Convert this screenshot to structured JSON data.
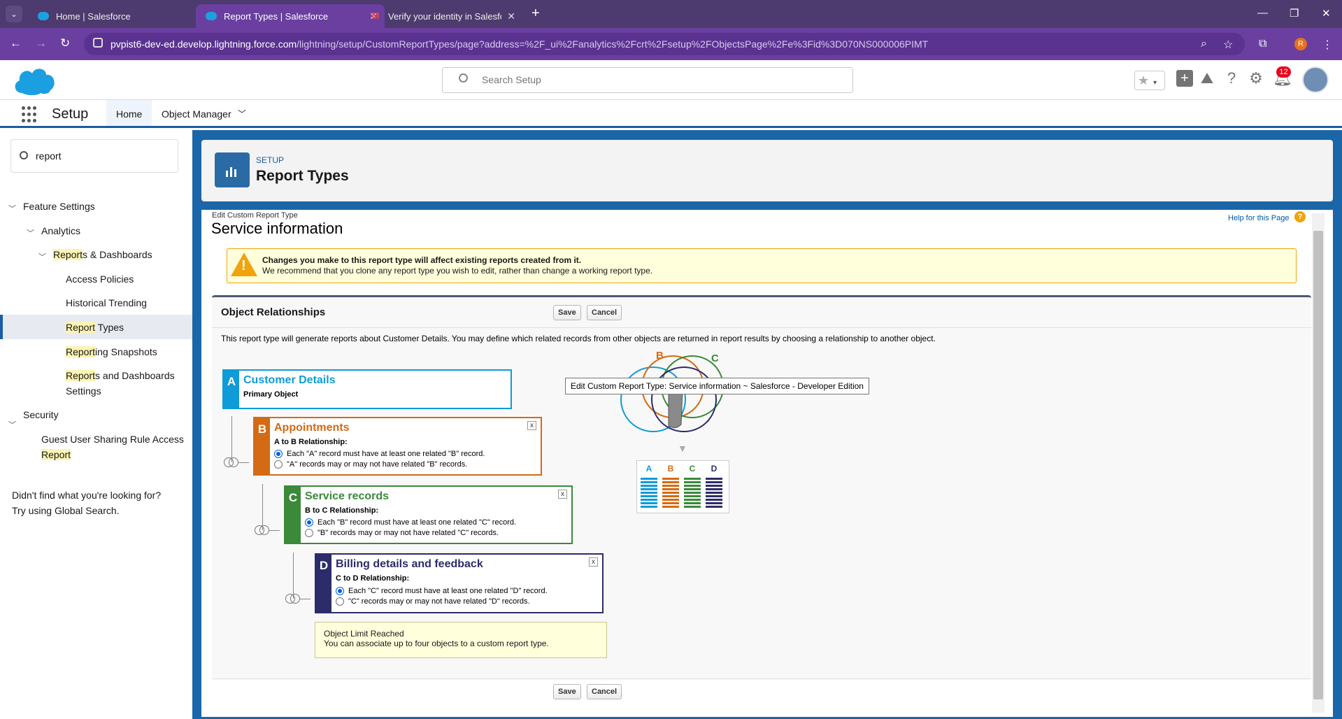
{
  "browser": {
    "tabs": [
      {
        "title": "Home | Salesforce"
      },
      {
        "title": "Report Types | Salesforce"
      },
      {
        "title": "Verify your identity in Salesforce"
      }
    ],
    "url_host": "pvpist6-dev-ed.develop.lightning.force.com",
    "url_path": "/lightning/setup/CustomReportTypes/page?address=%2F_ui%2Fanalytics%2Fcrt%2Fsetup%2FObjectsPage%2Fe%3Fid%3D070NS000006PIMT",
    "profile_initial": "R"
  },
  "header": {
    "search_placeholder": "Search Setup",
    "notification_count": "12"
  },
  "nav": {
    "app_name": "Setup",
    "tabs": [
      {
        "label": "Home"
      },
      {
        "label": "Object Manager"
      }
    ]
  },
  "sidebar": {
    "quick_find": "report",
    "feature_settings": "Feature Settings",
    "analytics": "Analytics",
    "reports_dashboards": {
      "hl": "Report",
      "rest": "s & Dashboards"
    },
    "access_policies": "Access Policies",
    "historical_trending": "Historical Trending",
    "report_types": {
      "hl": "Report",
      "rest": " Types"
    },
    "reporting_snapshots": {
      "hl": "Report",
      "rest": "ing Snapshots"
    },
    "reports_dash_settings": {
      "hl": "Report",
      "rest": "s and Dashboards",
      "line2": "Settings"
    },
    "security": "Security",
    "guest_user": {
      "line1": "Guest User Sharing Rule Access",
      "hl": "Report"
    },
    "not_found_1": "Didn't find what you're looking for?",
    "not_found_2": "Try using Global Search."
  },
  "page_header": {
    "kicker": "SETUP",
    "title": "Report Types"
  },
  "edit": {
    "label": "Edit Custom Report Type",
    "title": "Service information",
    "help": "Help for this Page",
    "warning_bold": "Changes you make to this report type will affect existing reports created from it.",
    "warning_text": "We recommend that you clone any report type you wish to edit, rather than change a working report type.",
    "section_title": "Object Relationships",
    "save": "Save",
    "cancel": "Cancel",
    "description": "This report type will generate reports about Customer Details. You may define which related records from other objects are returned in report results by choosing a relationship to another object.",
    "tooltip": "Edit Custom Report Type: Service information ~ Salesforce - Developer Edition",
    "limit_title": "Object Limit Reached",
    "limit_text": "You can associate up to four objects to a custom report type."
  },
  "objects": {
    "a": {
      "letter": "A",
      "name": "Customer Details",
      "sub": "Primary Object",
      "color": "#0f9bd7"
    },
    "b": {
      "letter": "B",
      "name": "Appointments",
      "sub": "A to B Relationship:",
      "opt1": "Each \"A\" record must have at least one related \"B\" record.",
      "opt2": "\"A\" records may or may not have related \"B\" records.",
      "color": "#d46a14"
    },
    "c": {
      "letter": "C",
      "name": "Service records",
      "sub": "B to C Relationship:",
      "opt1": "Each \"B\" record must have at least one related \"C\" record.",
      "opt2": "\"B\" records may or may not have related \"C\" records.",
      "color": "#3a8a3a"
    },
    "d": {
      "letter": "D",
      "name": "Billing details and feedback",
      "sub": "C to D Relationship:",
      "opt1": "Each \"C\" record must have at least one related \"D\" record.",
      "opt2": "\"C\" records may or may not have related \"D\" records.",
      "color": "#2c2c6a"
    }
  },
  "venn": {
    "label_b": "B",
    "label_c": "C",
    "cols": [
      "A",
      "B",
      "C",
      "D"
    ]
  },
  "close_glyph": "x"
}
